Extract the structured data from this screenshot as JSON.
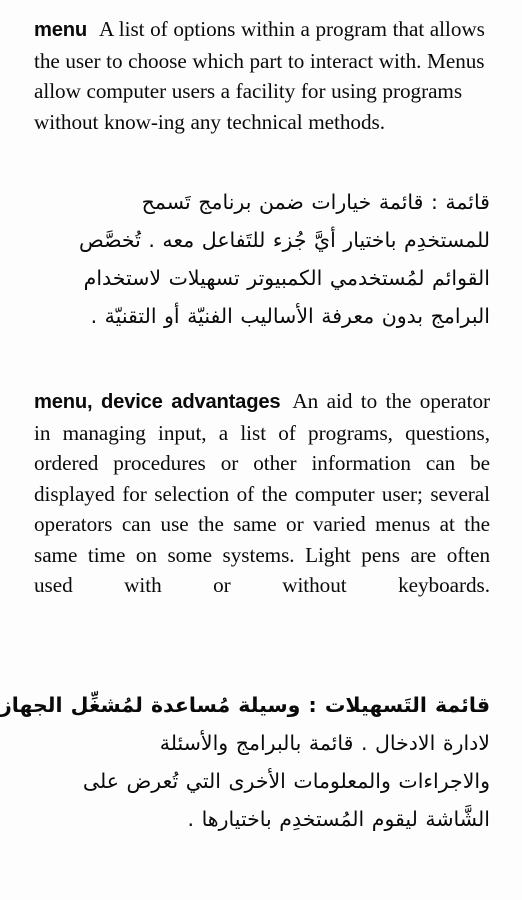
{
  "page": {
    "background_color": "#fdfdfd",
    "text_color": "#0a0a0a",
    "language_primary": "English",
    "language_secondary": "Arabic"
  },
  "entries": [
    {
      "headword": "menu",
      "definition_en": "A list of options within a program that allows the user to choose which part to interact with. Menus allow computer users a facility for using programs without know-ing any technical methods.",
      "definition_en_lines": [
        "A list of options within a program",
        "that allows the user to choose which part to",
        "interact with. Menus allow computer users",
        "a facility for using programs without know-",
        "ing any technical methods."
      ],
      "definition_ar": "قائمة : قائمة خيارات ضمن برنامج تَسمح للمستخدِم باختيار أيَّ جُزء للتَفاعل معه . تُخصَّص القوائم لمُستخدمي الكمبيوتر تسهيلات لاستخدام البرامج بدون معرفة الأساليب الفنيّة أو التقنيّة .",
      "definition_ar_lines": [
        "قائمة : قائمة خيارات ضمن برنامج تَسمح",
        "للمستخدِم باختيار أيَّ جُزء للتَفاعل معه . تُخصَّص",
        "القوائم لمُستخدمي الكمبيوتر تسهيلات لاستخدام",
        "البرامج بدون معرفة الأساليب الفنيّة أو التقنيّة ."
      ]
    },
    {
      "headword": "menu, device advantages",
      "definition_en": "An aid to the operator in managing input, a list of programs, questions, ordered procedures or other information can be displayed for selection of the computer user; several operators can use the same or varied menus at the same time on some systems. Light pens are often used with or without keyboards.",
      "definition_en_lines": [
        "An aid to",
        "the operator in managing input, a list of",
        "programs, questions, ordered procedures",
        "or other information can be displayed for",
        "selection of the computer user; several",
        "operators can use the same or varied",
        "menus at the same time on some systems.",
        "Light pens are often used with or without",
        "keyboards."
      ],
      "definition_ar": "قائمة التَسهيلات : وسيلة مُساعدة لمُشغِّل الجهاز لادارة الادخال . قائمة بالبرامج والأسئلة والاجراءات والمعلومات الأخرى التي تُعرض على الشَّاشة ليقوم المُستخدِم باختيارها .",
      "definition_ar_lines": [
        "قائمة التَسهيلات : وسيلة مُساعدة لمُشغِّل الجهاز",
        "لادارة الادخال . قائمة بالبرامج والأسئلة",
        "والاجراءات والمعلومات الأخرى التي تُعرض على",
        "الشَّاشة ليقوم المُستخدِم باختيارها ."
      ]
    }
  ]
}
